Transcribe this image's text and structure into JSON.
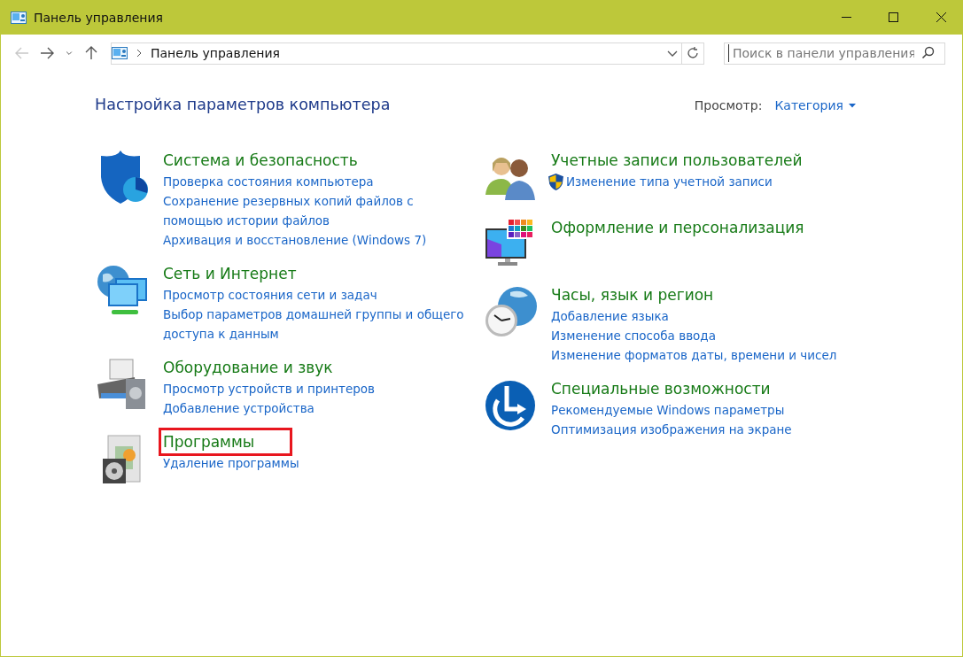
{
  "window": {
    "title": "Панель управления"
  },
  "navigation": {
    "back_disabled": true,
    "forward_disabled": false
  },
  "address_bar": {
    "path": "Панель управления"
  },
  "search": {
    "placeholder": "Поиск в панели управления"
  },
  "page_title": "Настройка параметров компьютера",
  "view": {
    "label": "Просмотр:",
    "value": "Категория"
  },
  "columns": [
    [
      {
        "title": "Система и безопасность",
        "highlighted": false,
        "links": [
          {
            "text": "Проверка состояния компьютера",
            "shield": false
          },
          {
            "text": "Сохранение резервных копий файлов с помощью истории файлов",
            "shield": false
          },
          {
            "text": "Архивация и восстановление (Windows 7)",
            "shield": false
          }
        ]
      },
      {
        "title": "Сеть и Интернет",
        "highlighted": false,
        "links": [
          {
            "text": "Просмотр состояния сети и задач",
            "shield": false
          },
          {
            "text": "Выбор параметров домашней группы и общего доступа к данным",
            "shield": false
          }
        ]
      },
      {
        "title": "Оборудование и звук",
        "highlighted": false,
        "links": [
          {
            "text": "Просмотр устройств и принтеров",
            "shield": false
          },
          {
            "text": "Добавление устройства",
            "shield": false
          }
        ]
      },
      {
        "title": "Программы",
        "highlighted": true,
        "links": [
          {
            "text": "Удаление программы",
            "shield": false
          }
        ]
      }
    ],
    [
      {
        "title": "Учетные записи пользователей",
        "highlighted": false,
        "links": [
          {
            "text": "Изменение типа учетной записи",
            "shield": true
          }
        ]
      },
      {
        "title": "Оформление и персонализация",
        "highlighted": false
      },
      {
        "title": "Часы, язык и регион",
        "highlighted": false,
        "links": [
          {
            "text": "Добавление языка",
            "shield": false
          },
          {
            "text": "Изменение способа ввода",
            "shield": false
          },
          {
            "text": "Изменение форматов даты, времени и чисел",
            "shield": false
          }
        ]
      },
      {
        "title": "Специальные возможности",
        "highlighted": false,
        "links": [
          {
            "text": "Рекомендуемые Windows параметры",
            "shield": false
          },
          {
            "text": "Оптимизация изображения на экране",
            "shield": false
          }
        ]
      }
    ]
  ]
}
